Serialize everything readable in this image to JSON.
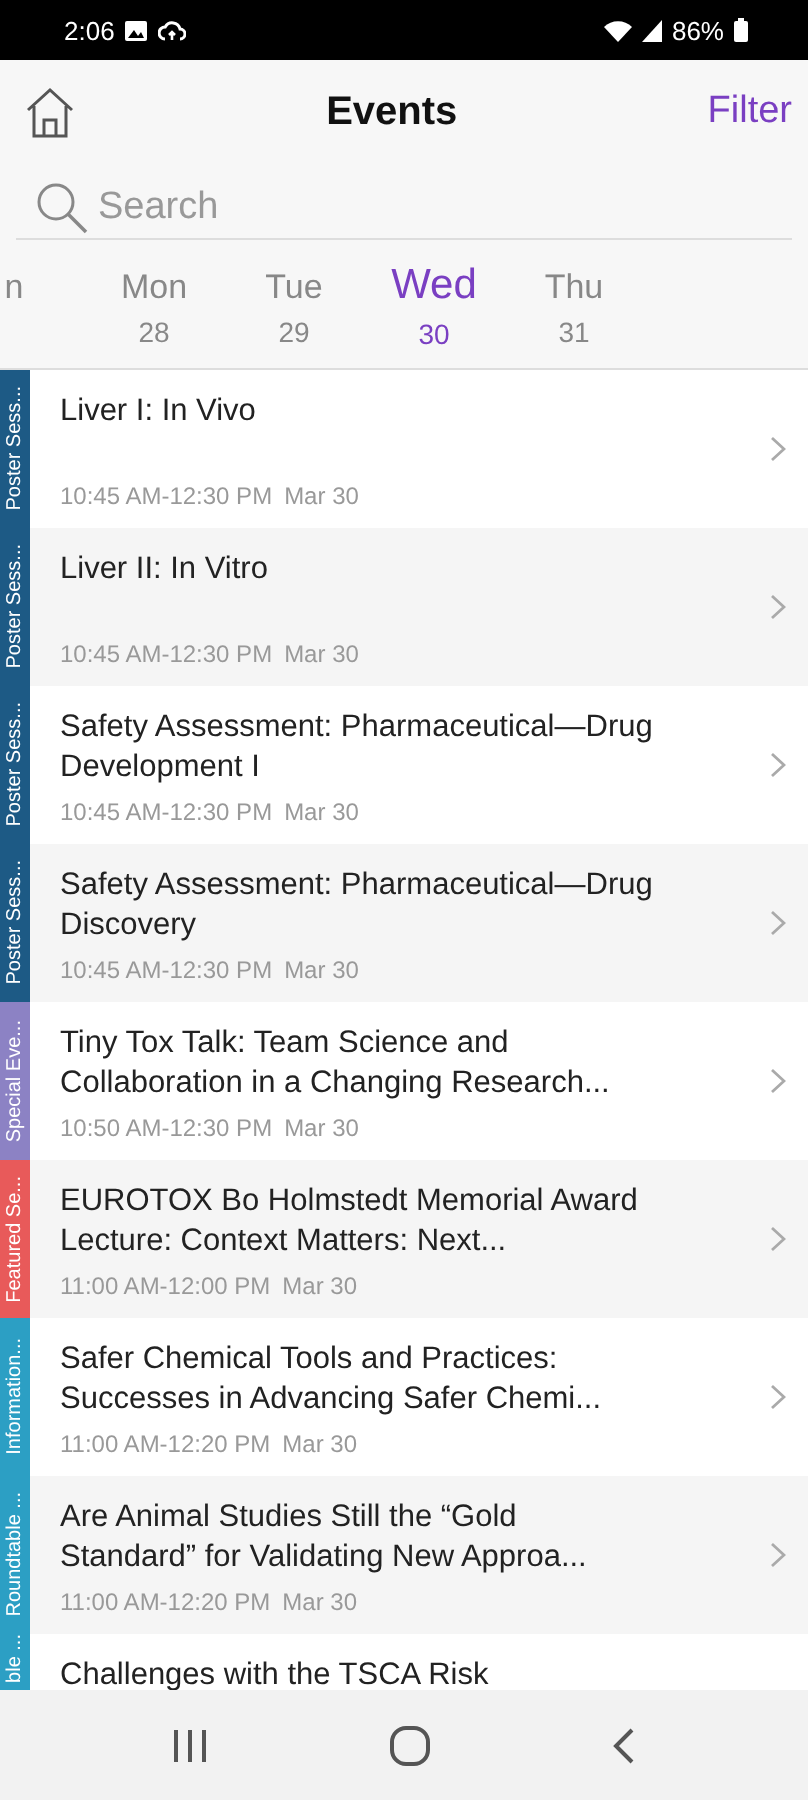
{
  "status_bar": {
    "time": "2:06",
    "battery": "86%"
  },
  "header": {
    "title": "Events",
    "filter": "Filter"
  },
  "search": {
    "placeholder": "Search"
  },
  "days": [
    {
      "name": "n",
      "selected": false
    },
    {
      "name": "Mon",
      "date": "28",
      "selected": false
    },
    {
      "name": "Tue",
      "date": "29",
      "selected": false
    },
    {
      "name": "Wed",
      "date": "30",
      "selected": true
    },
    {
      "name": "Thu",
      "date": "31",
      "selected": false
    }
  ],
  "events": [
    {
      "category": "Poster Sess...",
      "color": "#1d5a85",
      "title": "Liver I: In Vivo",
      "time": "10:45 AM-12:30 PM",
      "date": "Mar 30"
    },
    {
      "category": "Poster Sess...",
      "color": "#1d5a85",
      "title": "Liver II: In Vitro",
      "time": "10:45 AM-12:30 PM",
      "date": "Mar 30"
    },
    {
      "category": "Poster Sess...",
      "color": "#1d5a85",
      "title": "Safety Assessment: Pharmaceutical—Drug Development I",
      "time": "10:45 AM-12:30 PM",
      "date": "Mar 30"
    },
    {
      "category": "Poster Sess...",
      "color": "#1d5a85",
      "title": "Safety Assessment: Pharmaceutical—Drug Discovery",
      "time": "10:45 AM-12:30 PM",
      "date": "Mar 30"
    },
    {
      "category": "Special Eve...",
      "color": "#8c82c4",
      "title": "Tiny Tox Talk: Team Science and Collaboration in a Changing Research...",
      "time": "10:50 AM-12:30 PM",
      "date": "Mar 30"
    },
    {
      "category": "Featured Se...",
      "color": "#e85a5a",
      "title": "EUROTOX Bo Holmstedt Memorial Award Lecture: Context Matters: Next...",
      "time": "11:00 AM-12:00 PM",
      "date": "Mar 30"
    },
    {
      "category": "Information...",
      "color": "#2c9fc4",
      "title": "Safer Chemical Tools and Practices: Successes in Advancing Safer Chemi...",
      "time": "11:00 AM-12:20 PM",
      "date": "Mar 30"
    },
    {
      "category": "Roundtable ...",
      "color": "#2c9fc4",
      "title": "Are Animal Studies Still the “Gold Standard” for Validating New Approa...",
      "time": "11:00 AM-12:20 PM",
      "date": "Mar 30"
    },
    {
      "category": "ble ...",
      "color": "#2c9fc4",
      "title": "Challenges with the TSCA Risk",
      "partial": true
    }
  ]
}
